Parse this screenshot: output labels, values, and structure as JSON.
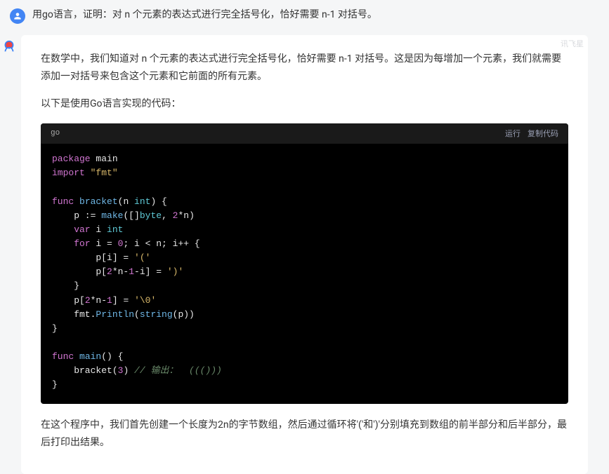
{
  "question": {
    "text": "用go语言，证明：对 n 个元素的表达式进行完全括号化，恰好需要 n-1 对括号。"
  },
  "watermark": "讯飞星",
  "answer": {
    "para1": "在数学中，我们知道对 n 个元素的表达式进行完全括号化，恰好需要 n-1 对括号。这是因为每增加一个元素，我们就需要添加一对括号来包含这个元素和它前面的所有元素。",
    "para2": "以下是使用Go语言实现的代码：",
    "para3": "在这个程序中，我们首先创建一个长度为2n的字节数组，然后通过循环将'('和')'分别填充到数组的前半部分和后半部分，最后打印出结果。"
  },
  "code": {
    "lang": "go",
    "run_label": "运行",
    "copy_label": "复制代码",
    "lines": {
      "l1_kw1": "package",
      "l1_id": " main",
      "l2_kw1": "import",
      "l2_str": " \"fmt\"",
      "l3_kw1": "func",
      "l3_fn": " bracket",
      "l3_sig1": "(n ",
      "l3_type1": "int",
      "l3_sig2": ") {",
      "l4_a": "    p := ",
      "l4_fn": "make",
      "l4_b": "([]",
      "l4_type": "byte",
      "l4_c": ", ",
      "l4_num": "2",
      "l4_d": "*n)",
      "l5_kw": "    var",
      "l5_rest": " i ",
      "l5_type": "int",
      "l6_kw": "    for",
      "l6_a": " i = ",
      "l6_n1": "0",
      "l6_b": "; i < n; i++ {",
      "l7_a": "        p[i] = ",
      "l7_str": "'('",
      "l8_a": "        p[",
      "l8_n": "2",
      "l8_b": "*n-",
      "l8_n2": "1",
      "l8_c": "-i] = ",
      "l8_str": "')'",
      "l9": "    }",
      "l10_a": "    p[",
      "l10_n": "2",
      "l10_b": "*n-",
      "l10_n2": "1",
      "l10_c": "] = ",
      "l10_str": "'\\0'",
      "l11_a": "    fmt.",
      "l11_fn": "Println",
      "l11_b": "(",
      "l11_fn2": "string",
      "l11_c": "(p))",
      "l12": "}",
      "l13_kw": "func",
      "l13_fn": " main",
      "l13_sig": "() {",
      "l14_a": "    bracket(",
      "l14_n": "3",
      "l14_b": ") ",
      "l14_cmt": "// 输出：  ((()))",
      "l15": "}"
    }
  }
}
